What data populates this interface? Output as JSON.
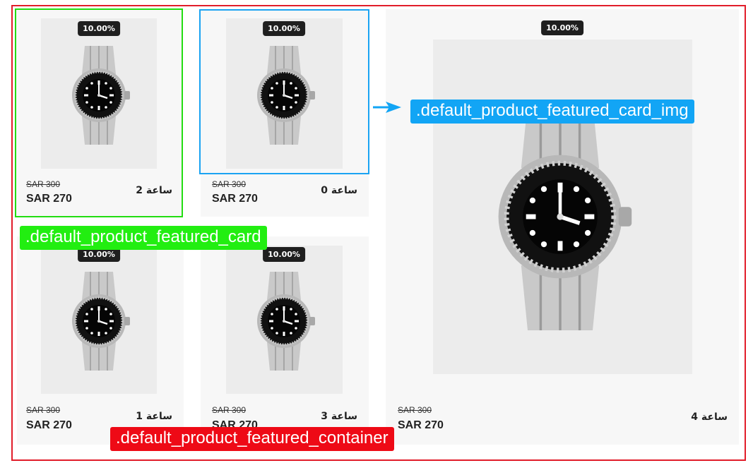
{
  "products": [
    {
      "title": "ساعة 2",
      "badge": "10.00%",
      "old_price": "SAR 300",
      "new_price": "SAR 270"
    },
    {
      "title": "ساعة 0",
      "badge": "10.00%",
      "old_price": "SAR 300",
      "new_price": "SAR 270"
    },
    {
      "title": "ساعة 1",
      "badge": "10.00%",
      "old_price": "SAR 300",
      "new_price": "SAR 270"
    },
    {
      "title": "ساعة 3",
      "badge": "10.00%",
      "old_price": "SAR 300",
      "new_price": "SAR 270"
    },
    {
      "title": "ساعة 4",
      "badge": "10.00%",
      "old_price": "SAR 300",
      "new_price": "SAR 270"
    }
  ],
  "annotations": {
    "img_label": ".default_product_featured_card_img",
    "card_label": ".default_product_featured_card",
    "container_label": ".default_product_featured_container"
  },
  "colors": {
    "container_outline": "#e11d2a",
    "card_outline": "#22dd11",
    "img_outline": "#1aa3f2"
  },
  "icons": {
    "product_image": "wristwatch-icon",
    "pointer": "arrow-right-icon"
  }
}
